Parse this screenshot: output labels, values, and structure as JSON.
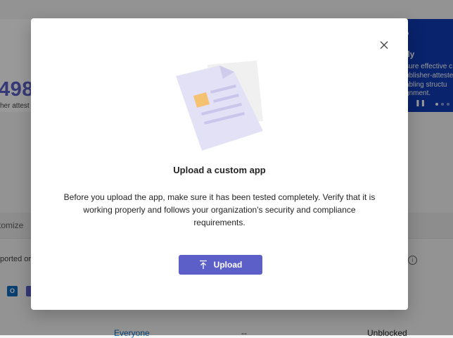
{
  "background": {
    "stat_value": "498",
    "stat_label": "her attest",
    "banner": {
      "title": "lly",
      "lines": [
        "sure effective c",
        "ublisher-atteste",
        "abling structu",
        "gnment."
      ]
    },
    "filter_text": "tomize",
    "row_text": "ported or",
    "cells": {
      "link": "Everyone",
      "dash": "--",
      "status": "Unblocked"
    }
  },
  "dialog": {
    "title": "Upload a custom app",
    "body": "Before you upload the app, make sure it has been tested completely. Verify that it is working properly and follows your organization's security and compliance requirements.",
    "upload_label": "Upload",
    "close_icon": "close-icon",
    "upload_icon": "upload-arrow-icon",
    "illustration": "document-illustration"
  },
  "colors": {
    "accent": "#5b5fc7",
    "banner": "#0f3bb5"
  }
}
